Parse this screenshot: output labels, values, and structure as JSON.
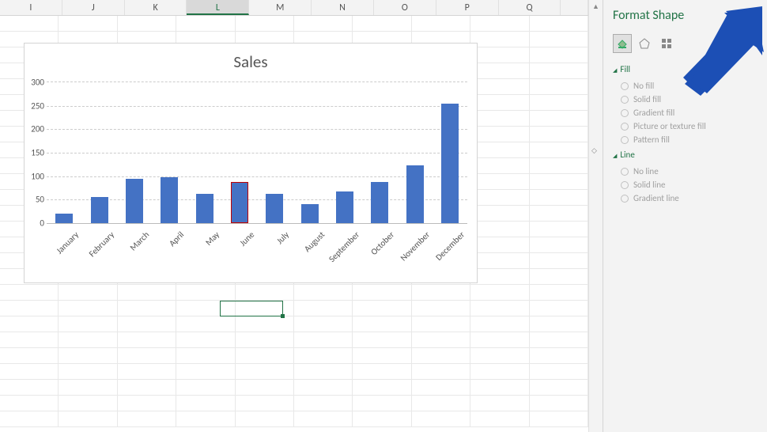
{
  "columns": [
    "I",
    "J",
    "K",
    "L",
    "M",
    "N",
    "O",
    "P",
    "Q"
  ],
  "selected_column": "L",
  "chart_data": {
    "type": "bar",
    "title": "Sales",
    "xlabel": "",
    "ylabel": "",
    "ylim": [
      0,
      300
    ],
    "yticks": [
      0,
      50,
      100,
      150,
      200,
      250,
      300
    ],
    "categories": [
      "January",
      "February",
      "March",
      "April",
      "May",
      "June",
      "July",
      "August",
      "September",
      "October",
      "November",
      "December"
    ],
    "values": [
      20,
      55,
      95,
      98,
      63,
      88,
      62,
      40,
      68,
      88,
      123,
      255
    ],
    "highlight_index": 5,
    "grid": true,
    "legend": false
  },
  "pane": {
    "title": "Format Shape",
    "tabs": [
      "fill-line",
      "effects",
      "size-properties"
    ],
    "sections": {
      "fill": {
        "label": "Fill",
        "options": {
          "no_fill": "No fill",
          "solid_fill": "Solid fill",
          "gradient_fill": "Gradient fill",
          "picture_fill": "Picture or texture fill",
          "pattern_fill": "Pattern fill"
        }
      },
      "line": {
        "label": "Line",
        "options": {
          "no_line": "No line",
          "solid_line": "Solid line",
          "gradient_line": "Gradient line"
        }
      }
    }
  }
}
